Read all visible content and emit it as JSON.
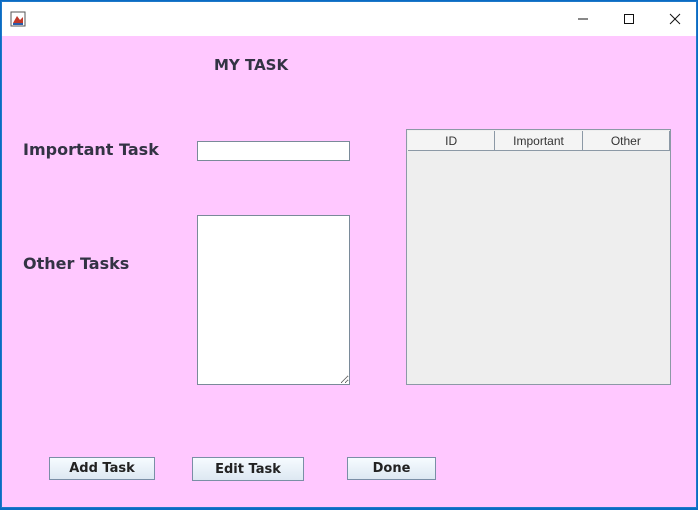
{
  "window": {
    "controls": {
      "minimize_icon": "minimize-icon",
      "maximize_icon": "maximize-icon",
      "close_icon": "close-icon"
    }
  },
  "form": {
    "heading": "MY TASK",
    "important_label": "Important Task",
    "important_value": "",
    "other_label": "Other Tasks",
    "other_value": ""
  },
  "table": {
    "columns": [
      "ID",
      "Important",
      "Other"
    ],
    "rows": []
  },
  "buttons": {
    "add": "Add Task",
    "edit": "Edit Task",
    "done": "Done"
  },
  "colors": {
    "background": "#ffc8ff",
    "table_bg": "#eeeeee"
  }
}
